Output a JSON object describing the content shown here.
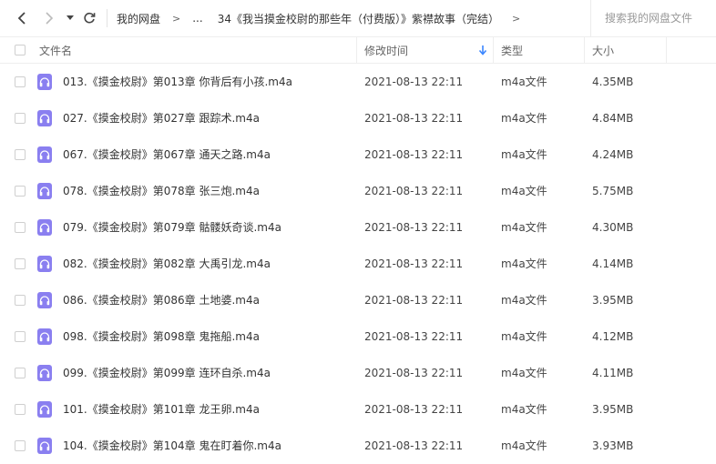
{
  "toolbar": {
    "breadcrumbs": [
      "我的网盘",
      "...",
      "34《我当摸金校尉的那些年（付费版）》紫襟故事（完结）"
    ],
    "sep": ">",
    "search_placeholder": "搜索我的网盘文件"
  },
  "header": {
    "name": "文件名",
    "modified": "修改时间",
    "type": "类型",
    "size": "大小"
  },
  "colors": {
    "icon": "#8a7ff0",
    "sort_arrow": "#3a86ff"
  },
  "files": [
    {
      "name": "013.《摸金校尉》第013章 你背后有小孩.m4a",
      "time": "2021-08-13 22:11",
      "type": "m4a文件",
      "size": "4.35MB"
    },
    {
      "name": "027.《摸金校尉》第027章 跟踪术.m4a",
      "time": "2021-08-13 22:11",
      "type": "m4a文件",
      "size": "4.84MB"
    },
    {
      "name": "067.《摸金校尉》第067章 通天之路.m4a",
      "time": "2021-08-13 22:11",
      "type": "m4a文件",
      "size": "4.24MB"
    },
    {
      "name": "078.《摸金校尉》第078章 张三炮.m4a",
      "time": "2021-08-13 22:11",
      "type": "m4a文件",
      "size": "5.75MB"
    },
    {
      "name": "079.《摸金校尉》第079章 骷髅妖奇谈.m4a",
      "time": "2021-08-13 22:11",
      "type": "m4a文件",
      "size": "4.30MB"
    },
    {
      "name": "082.《摸金校尉》第082章 大禹引龙.m4a",
      "time": "2021-08-13 22:11",
      "type": "m4a文件",
      "size": "4.14MB"
    },
    {
      "name": "086.《摸金校尉》第086章 土地婆.m4a",
      "time": "2021-08-13 22:11",
      "type": "m4a文件",
      "size": "3.95MB"
    },
    {
      "name": "098.《摸金校尉》第098章 鬼拖船.m4a",
      "time": "2021-08-13 22:11",
      "type": "m4a文件",
      "size": "4.12MB"
    },
    {
      "name": "099.《摸金校尉》第099章 连环自杀.m4a",
      "time": "2021-08-13 22:11",
      "type": "m4a文件",
      "size": "4.11MB"
    },
    {
      "name": "101.《摸金校尉》第101章 龙王卵.m4a",
      "time": "2021-08-13 22:11",
      "type": "m4a文件",
      "size": "3.95MB"
    },
    {
      "name": "104.《摸金校尉》第104章 鬼在盯着你.m4a",
      "time": "2021-08-13 22:11",
      "type": "m4a文件",
      "size": "3.93MB"
    }
  ]
}
